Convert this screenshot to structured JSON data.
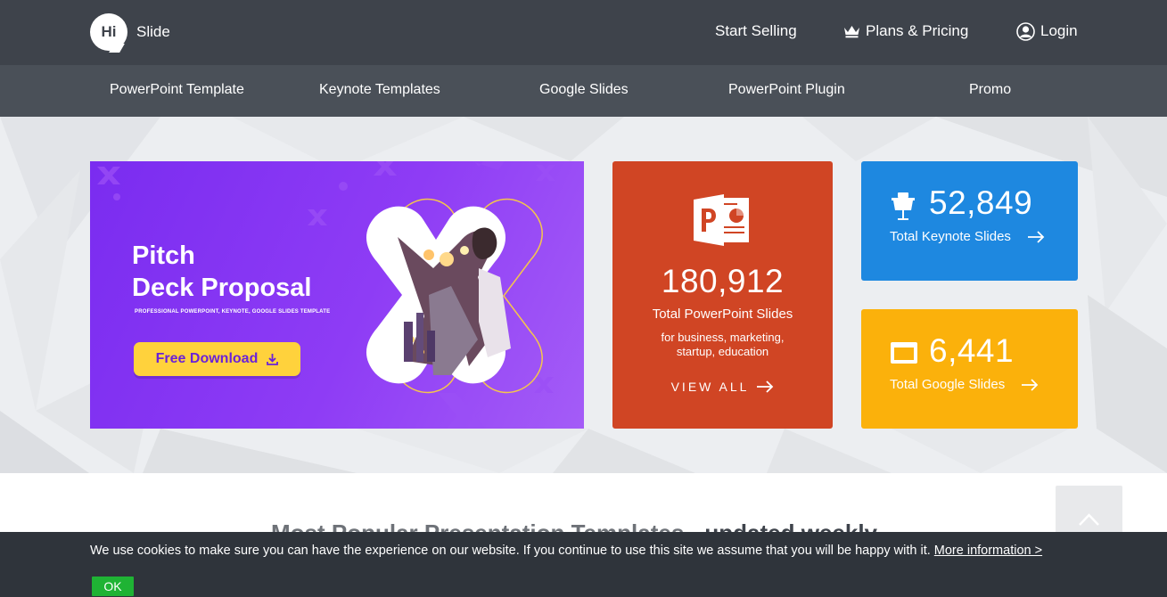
{
  "header": {
    "logo_text": "Hi",
    "brand": "Slide",
    "start_selling": "Start Selling",
    "plans_pricing": "Plans & Pricing",
    "login": "Login"
  },
  "subnav": [
    {
      "label": "PowerPoint Template"
    },
    {
      "label": "Keynote Templates"
    },
    {
      "label": "Google Slides"
    },
    {
      "label": "PowerPoint Plugin"
    },
    {
      "label": "Promo"
    }
  ],
  "promo": {
    "title_line1": "Pitch",
    "title_line2": "Deck Proposal",
    "subtitle": "PROFESSIONAL POWERPOINT, KEYNOTE, GOOGLE SLIDES TEMPLATE",
    "button": "Free Download",
    "colors": {
      "bg": "#7a2cf0",
      "button": "#ffd23c"
    }
  },
  "stats": {
    "powerpoint": {
      "count": "180,912",
      "label": "Total PowerPoint Slides",
      "description": "for business, marketing, startup, education",
      "view_all": "VIEW ALL",
      "icon": "powerpoint-icon",
      "color": "#d04524"
    },
    "keynote": {
      "count": "52,849",
      "label": "Total Keynote Slides",
      "icon": "keynote-icon",
      "color": "#1e88e0"
    },
    "google": {
      "count": "6,441",
      "label": "Total Google Slides",
      "icon": "google-slides-icon",
      "color": "#fbb10b"
    }
  },
  "section": {
    "title": "Most Popular Presentation Templates",
    "suffix": " - updated weekly"
  },
  "cookie": {
    "text": "We use cookies to make sure you can have the experience on our website. If you continue to use this site we assume that you will be happy with it. ",
    "link": "More information >",
    "ok": "OK"
  }
}
